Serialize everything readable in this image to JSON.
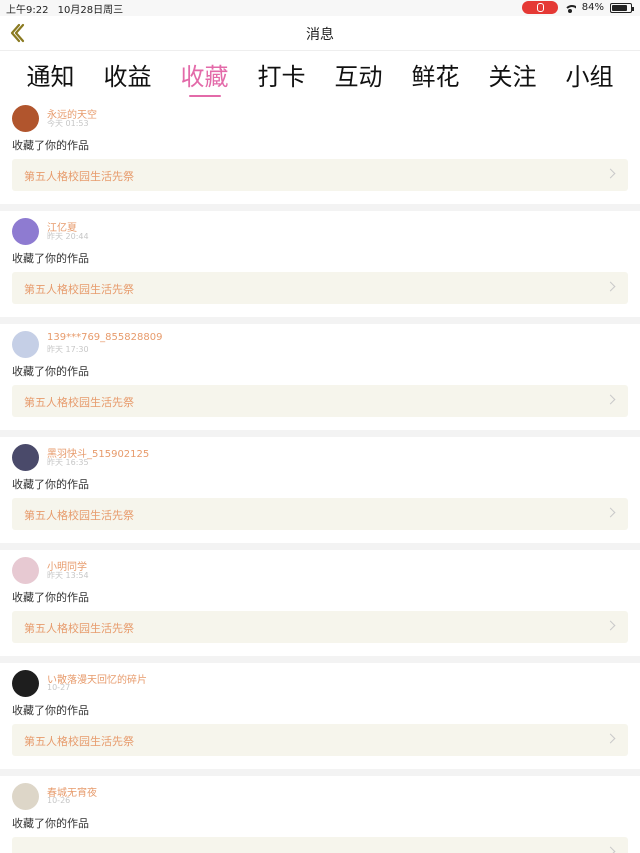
{
  "status_bar": {
    "time": "上午9:22",
    "date": "10月28日周三",
    "battery": "84%",
    "battery_level": 0.84
  },
  "nav": {
    "title": "消息"
  },
  "tabs": [
    {
      "label": "通知",
      "active": false
    },
    {
      "label": "收益",
      "active": false
    },
    {
      "label": "收藏",
      "active": true
    },
    {
      "label": "打卡",
      "active": false
    },
    {
      "label": "互动",
      "active": false
    },
    {
      "label": "鲜花",
      "active": false
    },
    {
      "label": "关注",
      "active": false
    },
    {
      "label": "小组",
      "active": false
    }
  ],
  "messages": [
    {
      "username": "永远的天空",
      "time": "今天 01:53",
      "action": "收藏了你的作品",
      "work_title": "第五人格校园生活先祭",
      "avatar_color": "#b1552d"
    },
    {
      "username": "江亿夏",
      "time": "昨天 20:44",
      "action": "收藏了你的作品",
      "work_title": "第五人格校园生活先祭",
      "avatar_color": "#8e7bd1"
    },
    {
      "username": "139***769_855828809",
      "time": "昨天 17:30",
      "action": "收藏了你的作品",
      "work_title": "第五人格校园生活先祭",
      "avatar_color": "#c5cfe6"
    },
    {
      "username": "黑羽快斗_515902125",
      "time": "昨天 16:35",
      "action": "收藏了你的作品",
      "work_title": "第五人格校园生活先祭",
      "avatar_color": "#4a4a6a"
    },
    {
      "username": "小明同学",
      "time": "昨天 13:54",
      "action": "收藏了你的作品",
      "work_title": "第五人格校园生活先祭",
      "avatar_color": "#e7c9d2"
    },
    {
      "username": "い散落漫天回忆的碎片",
      "time": "10-27",
      "action": "收藏了你的作品",
      "work_title": "第五人格校园生活先祭",
      "avatar_color": "#1e1e1e"
    },
    {
      "username": "春城无宵夜",
      "time": "10-26",
      "action": "收藏了你的作品",
      "work_title": "",
      "avatar_color": "#ddd6c8"
    }
  ]
}
